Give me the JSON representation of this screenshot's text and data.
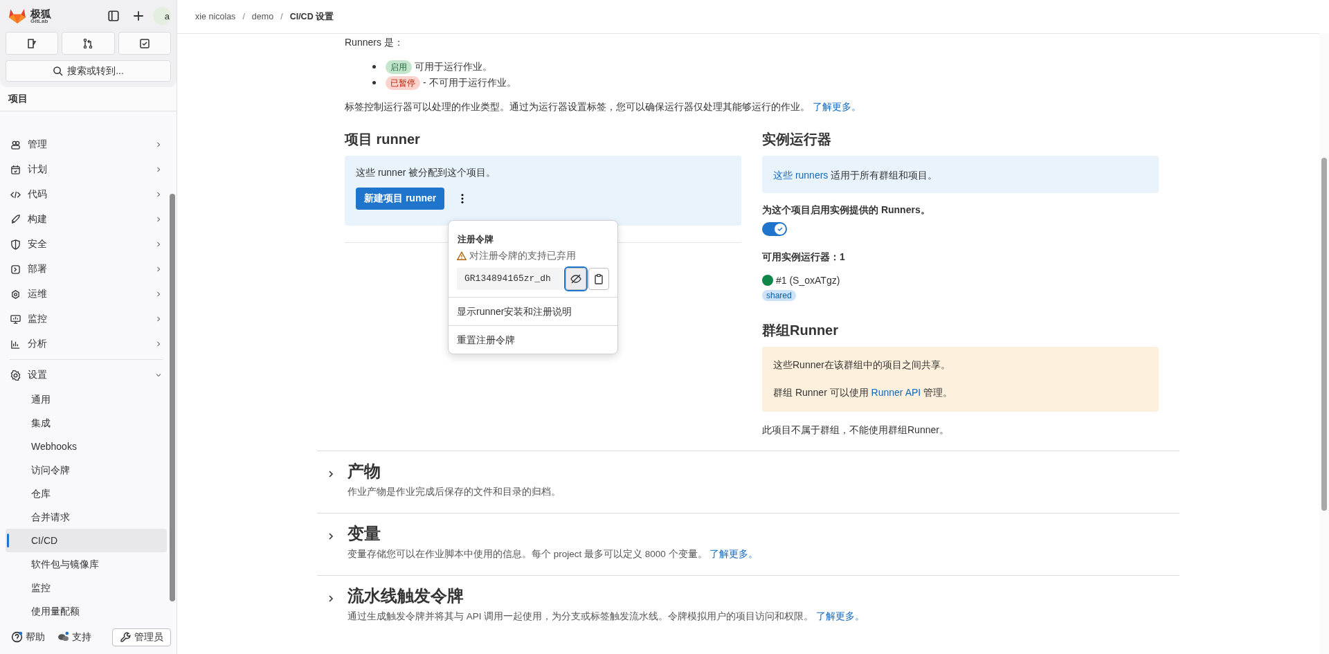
{
  "sidebar": {
    "brand": {
      "name": "极狐",
      "sub": "GitLab"
    },
    "avatar_text": "a",
    "search": {
      "placeholder": "搜索或转到..."
    },
    "context": "项目",
    "items": [
      {
        "label": "管理",
        "expanded": false
      },
      {
        "label": "计划",
        "expanded": false
      },
      {
        "label": "代码",
        "expanded": false
      },
      {
        "label": "构建",
        "expanded": false
      },
      {
        "label": "安全",
        "expanded": false
      },
      {
        "label": "部署",
        "expanded": false
      },
      {
        "label": "运维",
        "expanded": false
      },
      {
        "label": "监控",
        "expanded": false
      },
      {
        "label": "分析",
        "expanded": false
      },
      {
        "label": "设置",
        "expanded": true,
        "children": [
          {
            "label": "通用",
            "selected": false
          },
          {
            "label": "集成",
            "selected": false
          },
          {
            "label": "Webhooks",
            "selected": false
          },
          {
            "label": "访问令牌",
            "selected": false
          },
          {
            "label": "仓库",
            "selected": false
          },
          {
            "label": "合并请求",
            "selected": false
          },
          {
            "label": "CI/CD",
            "selected": true
          },
          {
            "label": "软件包与镜像库",
            "selected": false
          },
          {
            "label": "监控",
            "selected": false
          },
          {
            "label": "使用量配额",
            "selected": false
          }
        ]
      }
    ],
    "footer": {
      "help": "帮助",
      "support": "支持",
      "admin": "管理员"
    }
  },
  "breadcrumbs": [
    "xie nicolas",
    "demo",
    "CI/CD 设置"
  ],
  "breadcrumb_separator": "/",
  "intro": {
    "title": "Runners 是：",
    "statuses": [
      {
        "badge": "启用",
        "kind": "online",
        "text": "可用于运行作业。"
      },
      {
        "badge": "已暂停",
        "kind": "paused",
        "text": "- 不可用于运行作业。"
      }
    ],
    "tags_text": "标签控制运行器可以处理的作业类型。通过为运行器设置标签，您可以确保运行器仅处理其能够运行的作业。",
    "link": "了解更多。"
  },
  "project_runners": {
    "title": "项目 runner",
    "info": "这些 runner 被分配到这个项目。",
    "button": "新建项目 runner",
    "menu_open": true,
    "menu": {
      "heading": "注册令牌",
      "warning": "对注册令牌的支持已弃用",
      "token": "GR134894165zr_dh",
      "items": [
        "显示runner安装和注册说明",
        "重置注册令牌"
      ]
    }
  },
  "instance_runners": {
    "title": "实例运行器",
    "info_link": "这些 runners",
    "info": "适用于所有群组和项目。",
    "toggle_label": "为这个项目启用实例提供的 Runners。",
    "toggle_on": true,
    "available": "可用实例运行器：1",
    "runners": [
      {
        "name": "#1 (S_oxATgz)",
        "color": "#108548",
        "tags": [
          "shared"
        ]
      }
    ]
  },
  "group_runners": {
    "title": "群组Runner",
    "info": "这些Runner在该群组中的项目之间共享。",
    "api_prefix": "群组 Runner 可以使用",
    "api_link": "Runner API",
    "api_suffix": "管理。",
    "note": "此项目不属于群组，不能使用群组Runner。"
  },
  "sections": [
    {
      "title": "产物",
      "expanded": false,
      "description": "作业产物是作业完成后保存的文件和目录的归档。"
    },
    {
      "title": "变量",
      "expanded": false,
      "description": "变量存储您可以在作业脚本中使用的信息。每个 project 最多可以定义 8000 个变量。",
      "link": "了解更多。"
    },
    {
      "title": "流水线触发令牌",
      "expanded": false,
      "description": "通过生成触发令牌并将其与 API 调用一起使用，为分支或标签触发流水线。令牌模拟用户的项目访问和权限。",
      "link": "了解更多。"
    }
  ]
}
